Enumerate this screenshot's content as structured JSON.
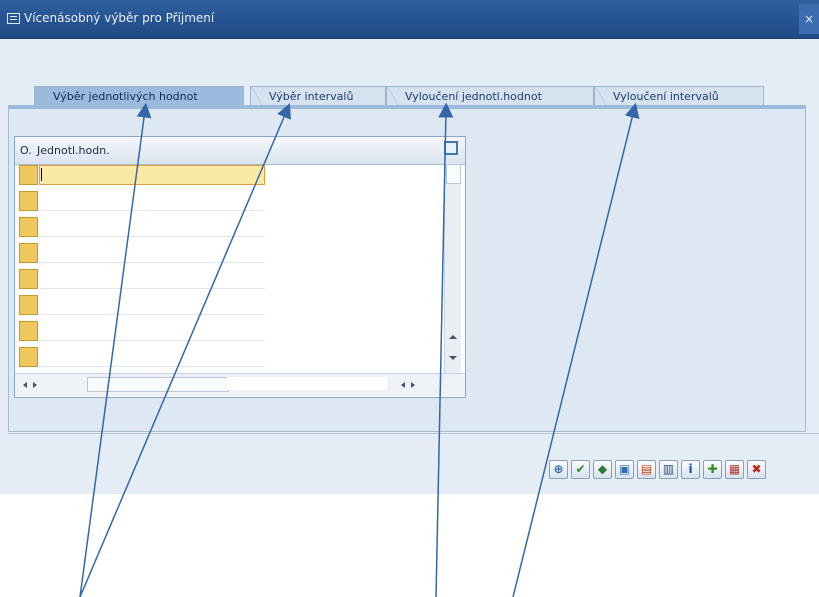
{
  "window": {
    "title": "Vícenásobný výběr pro Příjmení",
    "close_glyph": "×"
  },
  "tabs": [
    {
      "label": "Výběr jednotlivých hodnot",
      "active": true
    },
    {
      "label": "Výběr intervalů",
      "active": false
    },
    {
      "label": "Vyloučení jednotl.hodnot",
      "active": false
    },
    {
      "label": "Vyloučení intervalů",
      "active": false
    }
  ],
  "grid": {
    "col_option": "O.",
    "col_value": "Jednotl.hodn.",
    "rows": [
      "",
      "",
      "",
      "",
      "",
      "",
      "",
      ""
    ]
  },
  "toolbar": {
    "buttons": [
      {
        "name": "execute-button",
        "icon": "clock-execute-icon",
        "glyph": "⊕",
        "color": "#2e6db4"
      },
      {
        "name": "check-button",
        "icon": "checkmark-icon",
        "glyph": "✔",
        "color": "#2f8f22"
      },
      {
        "name": "insert-line-button",
        "icon": "insert-line-icon",
        "glyph": "◆",
        "color": "#2e7c3a"
      },
      {
        "name": "delete-line-button",
        "icon": "delete-line-icon",
        "glyph": "▣",
        "color": "#2e6db4"
      },
      {
        "name": "save-button",
        "icon": "save-icon",
        "glyph": "▤",
        "color": "#c04a1a"
      },
      {
        "name": "trash-button",
        "icon": "trash-icon",
        "glyph": "▥",
        "color": "#2b4f7f"
      },
      {
        "name": "info-button",
        "icon": "info-icon",
        "glyph": "i",
        "color": "#1f4fa8"
      },
      {
        "name": "import-button",
        "icon": "import-icon",
        "glyph": "✚",
        "color": "#2f8f22"
      },
      {
        "name": "clipboard-button",
        "icon": "clipboard-icon",
        "glyph": "▦",
        "color": "#b03a2e"
      },
      {
        "name": "cancel-button",
        "icon": "cancel-icon",
        "glyph": "✖",
        "color": "#c0261b"
      }
    ]
  },
  "colors": {
    "titlebar": "#2f5f9f",
    "active_tab": "#9cbbdc",
    "annotation_arrow": "#2f5f9f"
  }
}
